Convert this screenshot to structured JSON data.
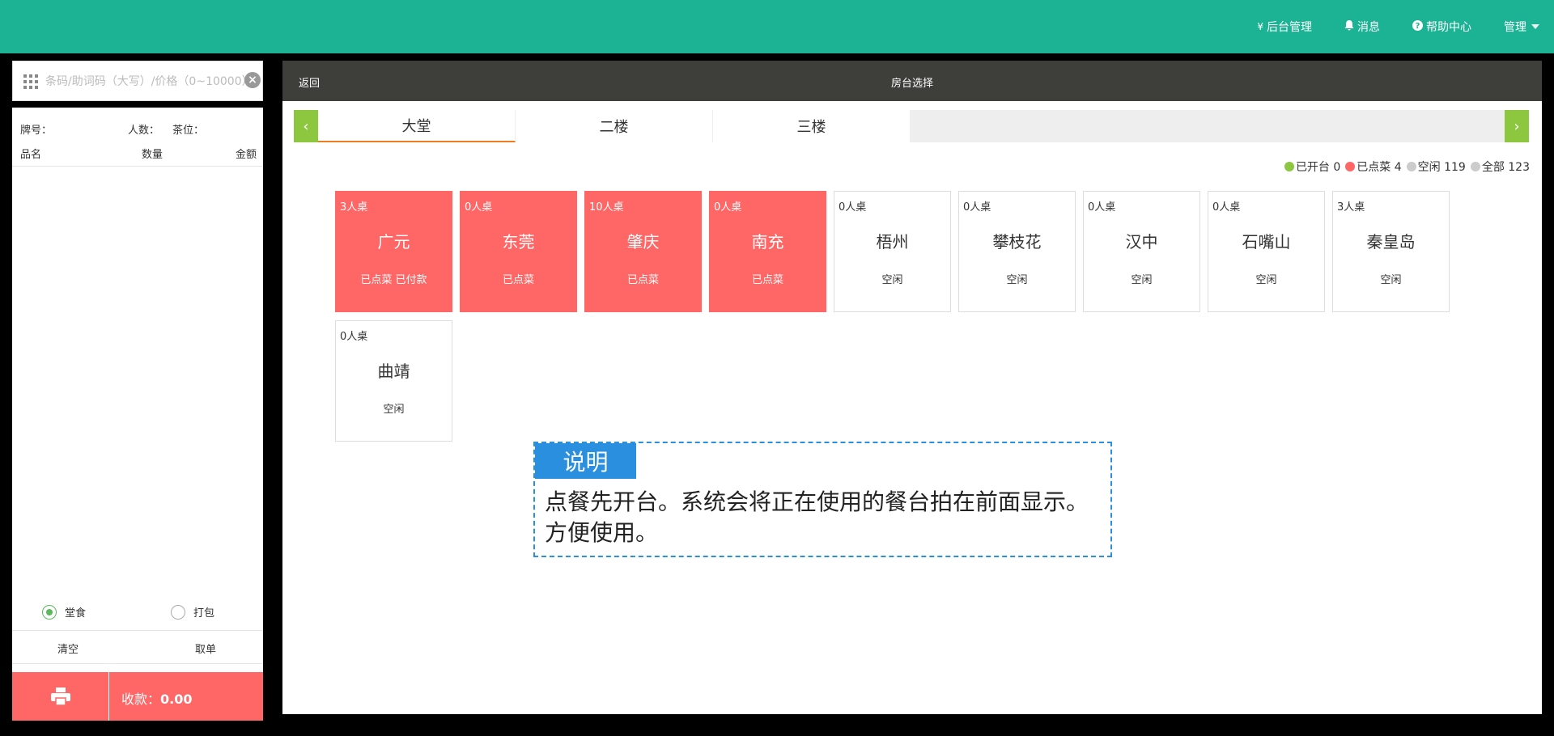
{
  "topnav": {
    "admin": {
      "icon": "yen-icon",
      "label": "后台管理"
    },
    "messages": {
      "icon": "bell-icon",
      "label": "消息"
    },
    "help": {
      "icon": "question-circle-icon",
      "label": "帮助中心"
    },
    "manage": {
      "label": "管理"
    }
  },
  "search": {
    "placeholder": "条码/助词码（大写）/价格（0~10000）"
  },
  "order": {
    "plate_label": "牌号：",
    "people_label": "人数：",
    "tea_label": "茶位：",
    "col_name": "品名",
    "col_qty": "数量",
    "col_amount": "金额",
    "dine_in": "堂食",
    "takeout": "打包",
    "selected_mode": "dine_in",
    "clear": "清空",
    "pickup": "取单",
    "pay_label": "收款：",
    "pay_amount": "0.00"
  },
  "main": {
    "back": "返回",
    "title": "房台选择"
  },
  "tabs": [
    {
      "label": "大堂",
      "active": true
    },
    {
      "label": "二楼",
      "active": false
    },
    {
      "label": "三楼",
      "active": false
    }
  ],
  "legend": [
    {
      "label": "已开台 0",
      "color": "#8dc63f"
    },
    {
      "label": "已点菜 4",
      "color": "#ff6666"
    },
    {
      "label": "空闲 119",
      "color": "#cccccc"
    },
    {
      "label": "全部 123",
      "color": "#cccccc"
    }
  ],
  "tables": [
    {
      "capacity": "3人桌",
      "name": "广元",
      "status": "已点菜 已付款",
      "occupied": true
    },
    {
      "capacity": "0人桌",
      "name": "东莞",
      "status": "已点菜",
      "occupied": true
    },
    {
      "capacity": "10人桌",
      "name": "肇庆",
      "status": "已点菜",
      "occupied": true
    },
    {
      "capacity": "0人桌",
      "name": "南充",
      "status": "已点菜",
      "occupied": true
    },
    {
      "capacity": "0人桌",
      "name": "梧州",
      "status": "空闲",
      "occupied": false
    },
    {
      "capacity": "0人桌",
      "name": "攀枝花",
      "status": "空闲",
      "occupied": false
    },
    {
      "capacity": "0人桌",
      "name": "汉中",
      "status": "空闲",
      "occupied": false
    },
    {
      "capacity": "0人桌",
      "name": "石嘴山",
      "status": "空闲",
      "occupied": false
    },
    {
      "capacity": "3人桌",
      "name": "秦皇岛",
      "status": "空闲",
      "occupied": false
    },
    {
      "capacity": "0人桌",
      "name": "曲靖",
      "status": "空闲",
      "occupied": false
    }
  ],
  "note": {
    "tag": "说明",
    "text": "点餐先开台。系统会将正在使用的餐台拍在前面显示。方便使用。"
  }
}
